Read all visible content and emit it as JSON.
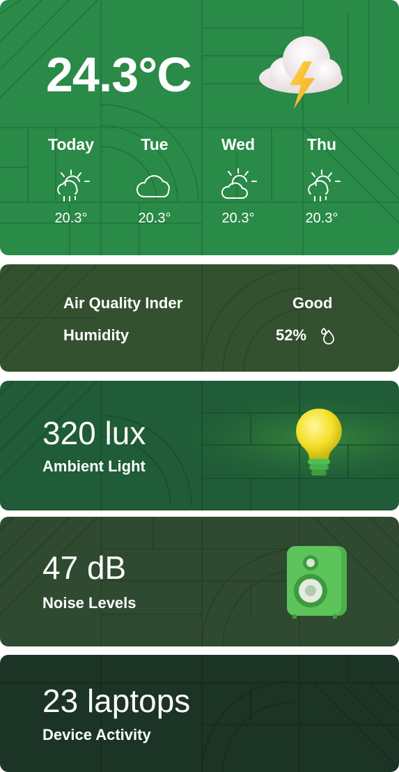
{
  "weather": {
    "temperature": "24.3°C",
    "main_icon": "thunderstorm-cloud-icon",
    "forecast": [
      {
        "day": "Today",
        "temp": "20.3°",
        "icon": "sun-rain-icon"
      },
      {
        "day": "Tue",
        "temp": "20.3°",
        "icon": "cloud-icon"
      },
      {
        "day": "Wed",
        "temp": "20.3°",
        "icon": "sun-cloud-icon"
      },
      {
        "day": "Thu",
        "temp": "20.3°",
        "icon": "sun-rain-icon"
      }
    ]
  },
  "air": {
    "quality_label": "Air Quality Inder",
    "quality_value": "Good",
    "humidity_label": "Humidity",
    "humidity_value": "52%",
    "humidity_icon": "droplets-icon"
  },
  "light": {
    "value": "320 lux",
    "label": "Ambient Light",
    "icon": "light-bulb-icon"
  },
  "noise": {
    "value": "47 dB",
    "label": "Noise Levels",
    "icon": "speaker-icon"
  },
  "devices": {
    "value": "23 laptops",
    "label": "Device Activity"
  },
  "colors": {
    "weather_bg": "#2a8a48",
    "air_bg": "#33512e",
    "light_bg": "#1f5c37",
    "noise_bg": "#2f4a30",
    "devices_bg": "#1b3425"
  }
}
